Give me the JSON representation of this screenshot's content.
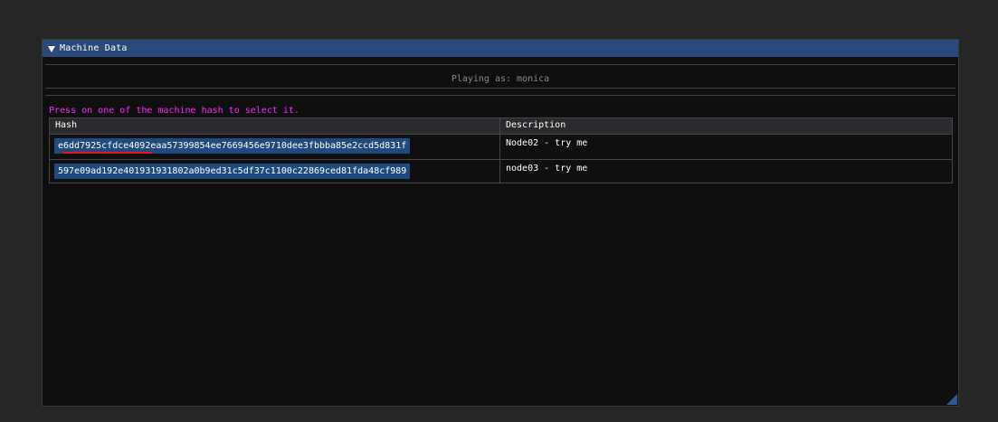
{
  "window": {
    "title": "Machine Data"
  },
  "header": {
    "playing_as": "Playing as: monica"
  },
  "hint": "Press on one of the machine hash to select it.",
  "table": {
    "columns": [
      "Hash",
      "Description"
    ],
    "rows": [
      {
        "hash": "e6dd7925cfdce4092eaa57399854ee7669456e9710dee3fbbba85e2ccd5d831f",
        "description": "Node02 - try me"
      },
      {
        "hash": "597e09ad192e401931931802a0b9ed31c5df37c1100c22869ced81fda48cf989",
        "description": "node03 - try me"
      }
    ]
  },
  "colors": {
    "titlebar": "#294a7a",
    "hint": "#ff22ff",
    "hash_button": "#1e4a7e",
    "annotation_underline": "#e01818"
  }
}
